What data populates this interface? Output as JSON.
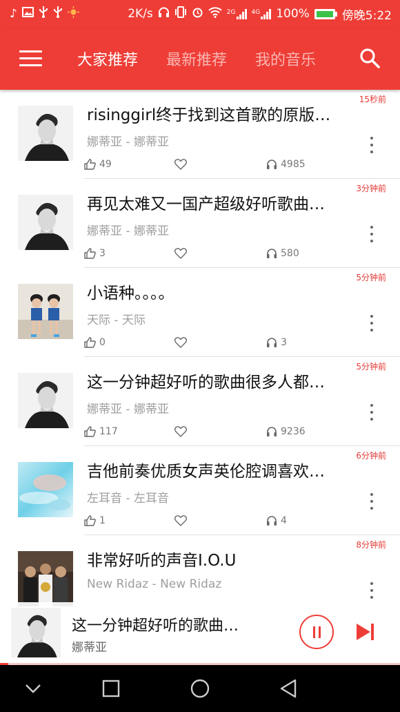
{
  "status_bar": {
    "network_speed": "2K/s",
    "network_type": "4G",
    "signal_label": "2G",
    "battery_percent": "100%",
    "time": "傍晚5:22",
    "left_icons": [
      "music-note-icon",
      "image-icon",
      "usb-icon",
      "usb-icon",
      "brightness-icon"
    ],
    "right_icons": [
      "headphones-icon",
      "vibrate-icon",
      "alarm-icon",
      "wifi-icon",
      "signal-icon",
      "signal-icon",
      "battery-icon"
    ]
  },
  "toolbar": {
    "tabs": [
      {
        "label": "大家推荐",
        "active": true
      },
      {
        "label": "最新推荐",
        "active": false
      },
      {
        "label": "我的音乐",
        "active": false
      }
    ],
    "menu_icon": "hamburger-menu-icon",
    "search_icon": "search-icon"
  },
  "songs": [
    {
      "time": "15秒前",
      "title": "risinggirl终于找到这首歌的原版…",
      "artist": "娜蒂亚 - 娜蒂亚",
      "likes": "49",
      "plays": "4985",
      "thumb": "portrait-boy"
    },
    {
      "time": "3分钟前",
      "title": "再见太难又一国产超级好听歌曲…",
      "artist": "娜蒂亚 - 娜蒂亚",
      "likes": "3",
      "plays": "580",
      "thumb": "portrait-boy"
    },
    {
      "time": "5分钟前",
      "title": "小语种。。。。",
      "artist": "天际 - 天际",
      "likes": "0",
      "plays": "3",
      "thumb": "two-girls"
    },
    {
      "time": "5分钟前",
      "title": "这一分钟超好听的歌曲很多人都…",
      "artist": "娜蒂亚 - 娜蒂亚",
      "likes": "117",
      "plays": "9236",
      "thumb": "portrait-boy"
    },
    {
      "time": "6分钟前",
      "title": "吉他前奏优质女声英伦腔调喜欢…",
      "artist": "左耳音 - 左耳音",
      "likes": "1",
      "plays": "4",
      "thumb": "blue-dreamy"
    },
    {
      "time": "8分钟前",
      "title": "非常好听的声音I.O.U",
      "artist": "New Ridaz - New Ridaz",
      "likes": "",
      "plays": "",
      "thumb": "group-photo"
    }
  ],
  "mini_player": {
    "title": "这一分钟超好听的歌曲…",
    "artist": "娜蒂亚",
    "progress": 0.02
  },
  "colors": {
    "accent": "#ee3d36",
    "time_text": "#e53935",
    "text_secondary": "#9e9e9e"
  }
}
